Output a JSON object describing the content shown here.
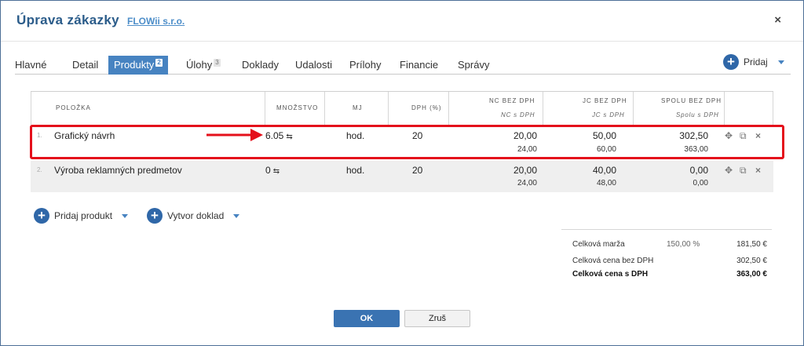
{
  "header": {
    "title": "Úprava zákazky",
    "company": "FLOWii s.r.o.",
    "close_icon": "×"
  },
  "tabs": [
    {
      "label": "Hlavné"
    },
    {
      "label": "Detail"
    },
    {
      "label": "Produkty",
      "count": "2",
      "active": true
    },
    {
      "label": "Úlohy",
      "count": "3"
    },
    {
      "label": "Doklady"
    },
    {
      "label": "Udalosti"
    },
    {
      "label": "Prílohy"
    },
    {
      "label": "Financie"
    },
    {
      "label": "Správy"
    }
  ],
  "add_button": {
    "icon": "plus-circle-icon",
    "label": "Pridaj"
  },
  "table": {
    "headers": {
      "polozka": "POLOŽKA",
      "mnozstvo": "MNOŽSTVO",
      "mj": "MJ",
      "dph": "DPH (%)",
      "nc": "NC BEZ DPH",
      "nc_sub": "NC s DPH",
      "jc": "JC BEZ DPH",
      "jc_sub": "JC s DPH",
      "spolu": "SPOLU BEZ DPH",
      "spolu_sub": "Spolu s DPH"
    },
    "rows": [
      {
        "num": "1.",
        "name": "Grafický návrh",
        "qty": "6.05",
        "unit": "hod.",
        "vat": "20",
        "nc": "20,00",
        "nc_vat": "24,00",
        "jc": "50,00",
        "jc_vat": "60,00",
        "total": "302,50",
        "total_vat": "363,00"
      },
      {
        "num": "2.",
        "name": "Výroba reklamných predmetov",
        "qty": "0",
        "unit": "hod.",
        "vat": "20",
        "nc": "20,00",
        "nc_vat": "24,00",
        "jc": "40,00",
        "jc_vat": "48,00",
        "total": "0,00",
        "total_vat": "0,00"
      }
    ]
  },
  "bottom_buttons": {
    "add_product": "Pridaj produkt",
    "create_document": "Vytvor doklad"
  },
  "totals": {
    "margin_label": "Celková marža",
    "margin_pct": "150,00 %",
    "margin_value": "181,50 €",
    "net_label": "Celková cena bez DPH",
    "net_value": "302,50 €",
    "gross_label": "Celková cena s DPH",
    "gross_value": "363,00 €"
  },
  "footer": {
    "ok": "OK",
    "cancel": "Zruš"
  },
  "colors": {
    "accent": "#4783c1",
    "title": "#2b5c8a",
    "highlight": "#e4101b",
    "ok_button": "#3a73b2"
  }
}
